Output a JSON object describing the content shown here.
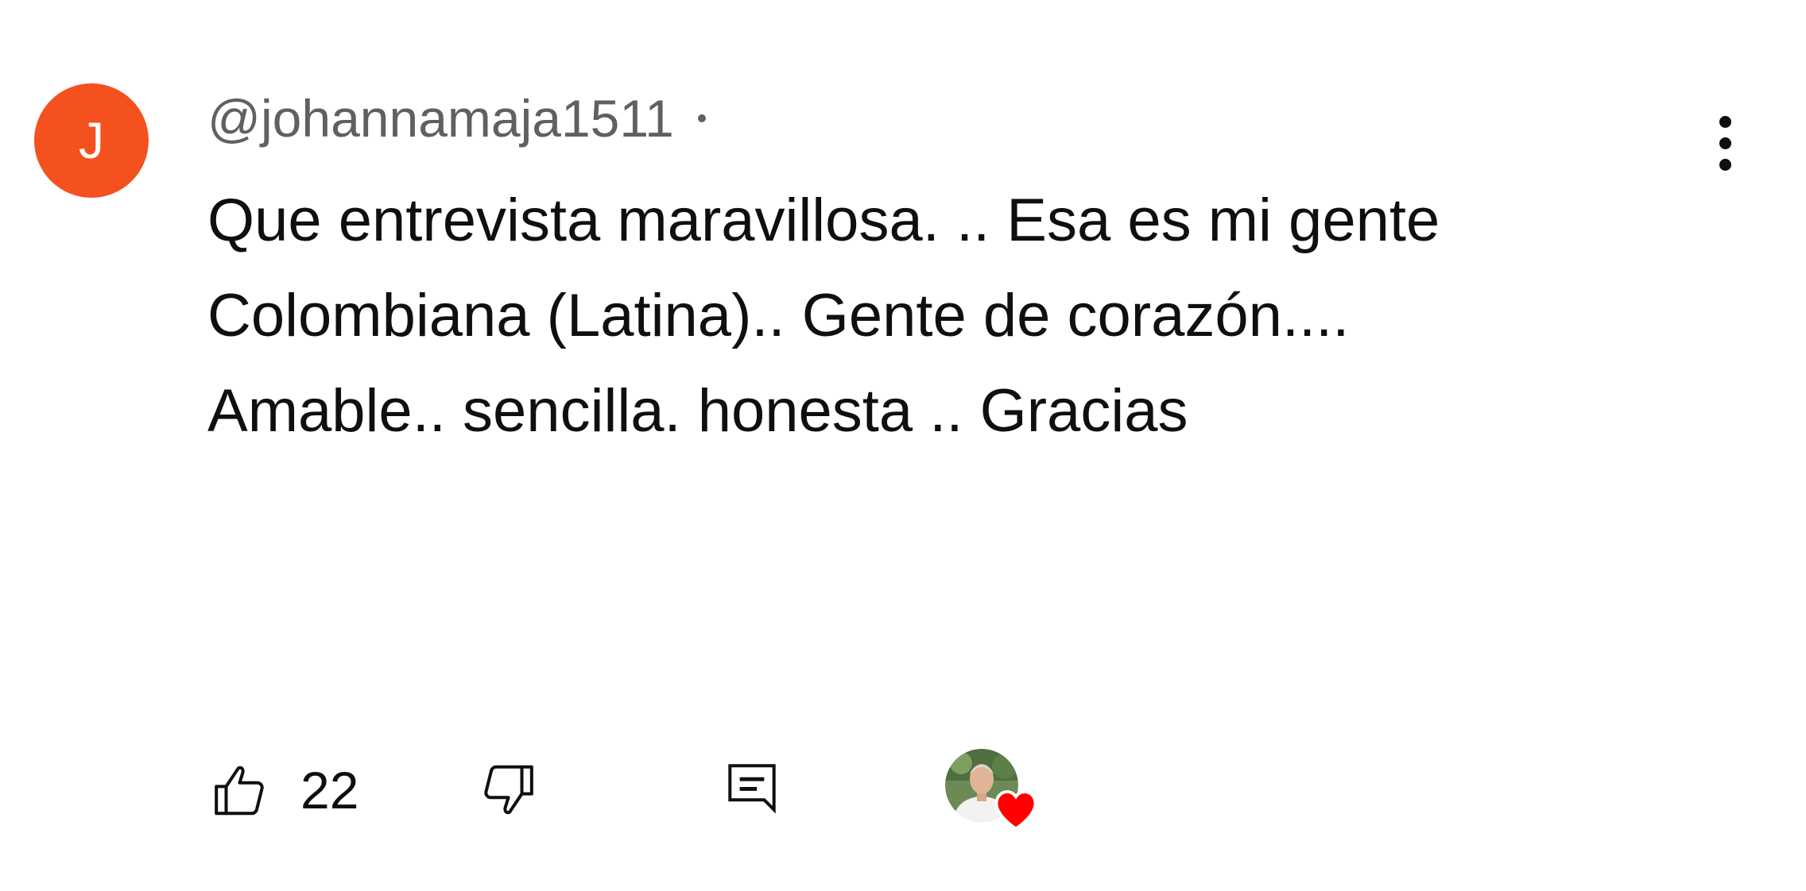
{
  "comment": {
    "author": {
      "initial": "J",
      "handle": "@johannamaja1511",
      "avatar_color": "#f4511e"
    },
    "text_lines": [
      "Que entrevista maravillosa. .. Esa es mi gente",
      "Colombiana (Latina).. Gente de corazón....",
      "Amable.. sencilla. honesta .. Gracias"
    ],
    "likes": "22",
    "creator_heart": true,
    "icons": {
      "like": "thumbs-up-icon",
      "dislike": "thumbs-down-icon",
      "reply": "comment-reply-icon",
      "more": "more-vertical-icon",
      "heart": "heart-icon"
    },
    "heart_color": "#ff0000"
  }
}
